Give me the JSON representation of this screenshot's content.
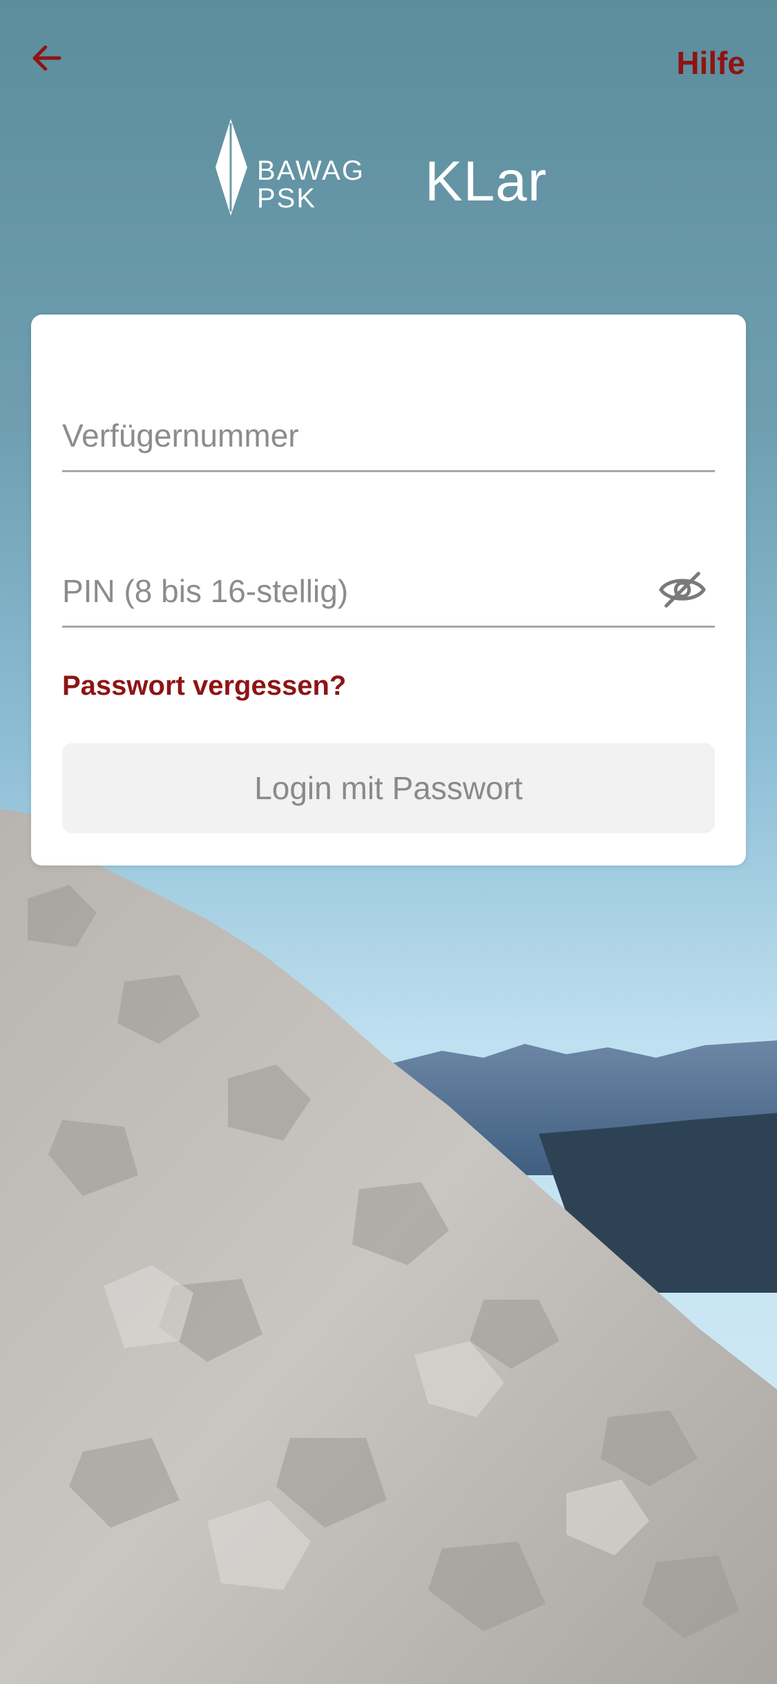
{
  "header": {
    "back_icon": "arrow-left-icon",
    "help_label": "Hilfe"
  },
  "logo": {
    "bank_name_line1": "BAWAG",
    "bank_name_line2": "PSK",
    "brand": "KLar"
  },
  "login_form": {
    "username_placeholder": "Verfügernummer",
    "username_value": "",
    "pin_placeholder": "PIN (8 bis 16-stellig)",
    "pin_value": "",
    "pin_visibility_icon": "eye-slash-icon",
    "forgot_password_label": "Passwort vergessen?",
    "login_button_label": "Login mit Passwort"
  },
  "colors": {
    "accent": "#8e1414",
    "card_background": "#ffffff",
    "button_disabled_background": "#f2f2f2",
    "button_disabled_text": "#8a8a8a",
    "placeholder_text": "#8c8c8c"
  }
}
